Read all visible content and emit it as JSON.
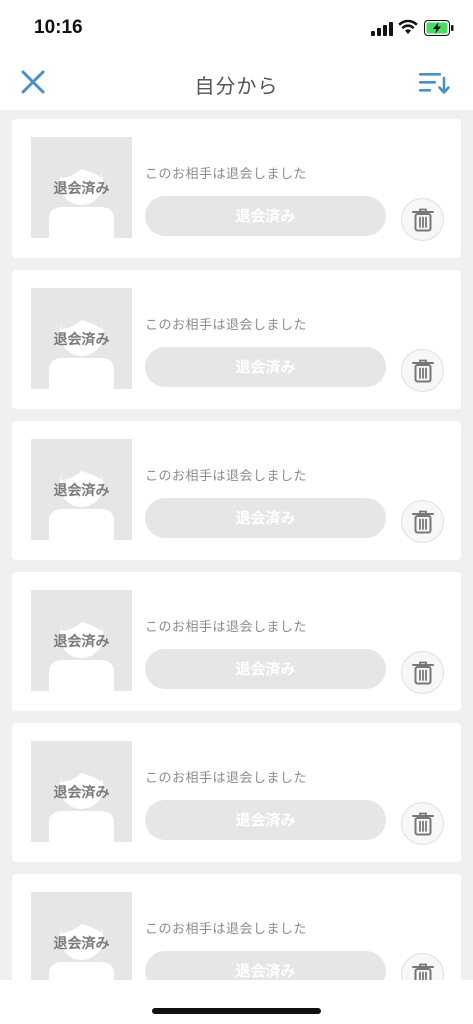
{
  "status_bar": {
    "time": "10:16",
    "signal_icon": "signal-bars-icon",
    "wifi_icon": "wifi-icon",
    "battery_icon": "battery-charging-icon"
  },
  "nav": {
    "title": "自分から",
    "close_icon": "close-icon",
    "sort_icon": "sort-icon",
    "accent_color": "#4a90c8"
  },
  "items": [
    {
      "avatar_label": "退会済み",
      "message": "このお相手は退会しました",
      "button_label": "退会済み"
    },
    {
      "avatar_label": "退会済み",
      "message": "このお相手は退会しました",
      "button_label": "退会済み"
    },
    {
      "avatar_label": "退会済み",
      "message": "このお相手は退会しました",
      "button_label": "退会済み"
    },
    {
      "avatar_label": "退会済み",
      "message": "このお相手は退会しました",
      "button_label": "退会済み"
    },
    {
      "avatar_label": "退会済み",
      "message": "このお相手は退会しました",
      "button_label": "退会済み"
    },
    {
      "avatar_label": "退会済み",
      "message": "このお相手は退会しました",
      "button_label": "退会済み"
    }
  ]
}
